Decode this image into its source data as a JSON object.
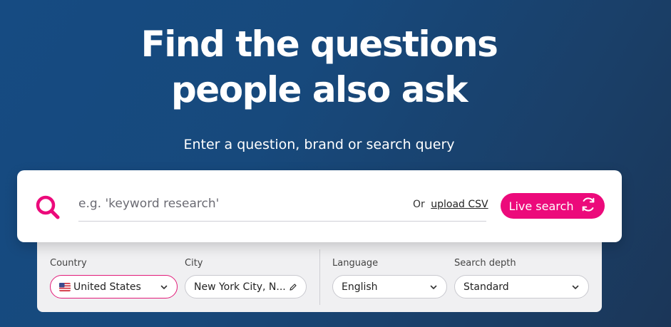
{
  "hero": {
    "title_line1": "Find the questions",
    "title_line2": "people also ask",
    "subtitle": "Enter a question, brand or search query"
  },
  "search": {
    "placeholder": "e.g. 'keyword research'",
    "or_text": "Or",
    "upload_label": "upload CSV",
    "button_label": "Live search",
    "icons": {
      "search": "search-icon",
      "button": "refresh-icon"
    }
  },
  "options": {
    "country": {
      "label": "Country",
      "value": "United States",
      "icon": "us-flag-icon"
    },
    "city": {
      "label": "City",
      "value": "New York City, N...",
      "icon": "pencil-icon"
    },
    "language": {
      "label": "Language",
      "value": "English"
    },
    "depth": {
      "label": "Search depth",
      "value": "Standard"
    }
  },
  "colors": {
    "accent": "#ec0a7b",
    "background": "#164b82",
    "panel": "#f0f0f2"
  }
}
